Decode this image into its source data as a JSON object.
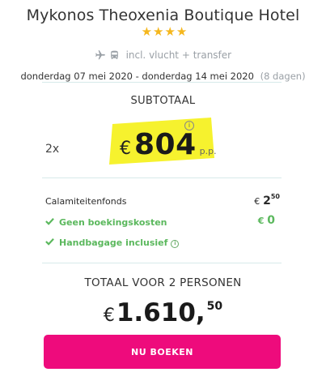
{
  "hotel": {
    "name": "Mykonos Theoxenia Boutique Hotel",
    "stars": "★★★★",
    "transport_label": "incl. vlucht + transfer"
  },
  "dates": {
    "start": "donderdag 07 mei 2020",
    "separator": "-",
    "end": "donderdag 14 mei 2020",
    "nights": "(8 dagen)"
  },
  "subtotal": {
    "title": "SUBTOTAAL",
    "quantity": "2x",
    "currency": "€",
    "amount": "804",
    "per_person": "p.p.",
    "info_icon": "i"
  },
  "fees": [
    {
      "label": "Calamiteitenfonds",
      "currency": "€",
      "value": "2",
      "cents": "50"
    },
    {
      "label": "Geen boekingskosten",
      "currency": "€",
      "value": "0"
    },
    {
      "label": "Handbagage inclusief",
      "info": "i"
    }
  ],
  "total": {
    "title": "TOTAAL VOOR 2 PERSONEN",
    "currency": "€",
    "amount": "1.610,",
    "cents": "50"
  },
  "cta": {
    "label": "NU BOEKEN"
  },
  "colors": {
    "accent": "#ee0b7c",
    "highlight": "#f6f22e",
    "green": "#5bb85d",
    "star": "#f5b71d"
  }
}
